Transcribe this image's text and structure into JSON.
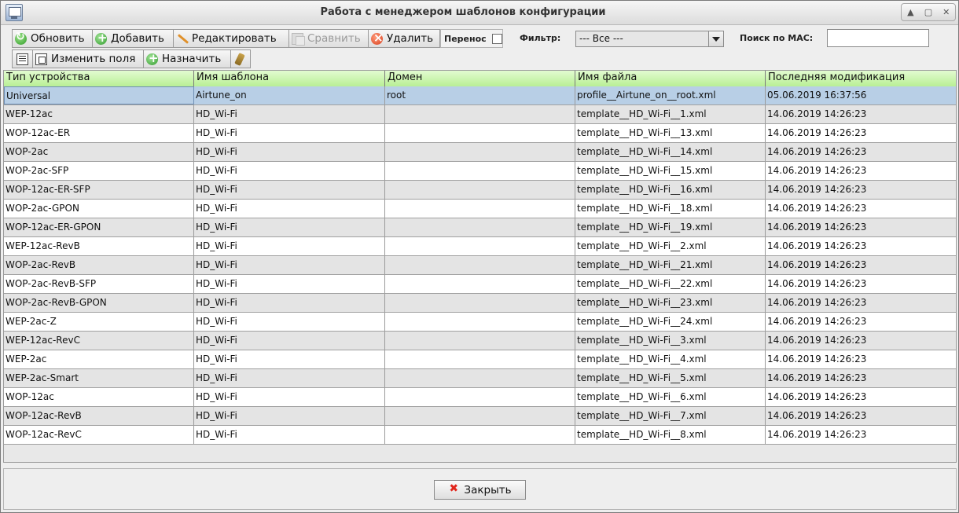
{
  "window": {
    "title": "Работа с менеджером шаблонов конфигурации",
    "controls": [
      "▲",
      "▢",
      "✕"
    ]
  },
  "toolbar": {
    "refresh_label": "Обновить",
    "add_label": "Добавить",
    "edit_label": "Редактировать",
    "compare_label": "Сравнить",
    "delete_label": "Удалить",
    "transfer_label": "Перенос",
    "transfer_checked": false,
    "change_fields_label": "Изменить поля",
    "assign_label": "Назначить",
    "filter_label": "Фильтр:",
    "filter_value": "--- Все ---",
    "mac_search_label": "Поиск по MAC:",
    "mac_search_value": ""
  },
  "table": {
    "columns": [
      "Тип устройства",
      "Имя шаблона",
      "Домен",
      "Имя файла",
      "Последняя модификация"
    ],
    "selected_row": 0,
    "rows": [
      [
        "Universal",
        "Airtune_on",
        "root",
        "profile__Airtune_on__root.xml",
        "05.06.2019 16:37:56"
      ],
      [
        "WEP-12ac",
        "HD_Wi-Fi",
        "",
        "template__HD_Wi-Fi__1.xml",
        "14.06.2019 14:26:23"
      ],
      [
        "WOP-12ac-ER",
        "HD_Wi-Fi",
        "",
        "template__HD_Wi-Fi__13.xml",
        "14.06.2019 14:26:23"
      ],
      [
        "WOP-2ac",
        "HD_Wi-Fi",
        "",
        "template__HD_Wi-Fi__14.xml",
        "14.06.2019 14:26:23"
      ],
      [
        "WOP-2ac-SFP",
        "HD_Wi-Fi",
        "",
        "template__HD_Wi-Fi__15.xml",
        "14.06.2019 14:26:23"
      ],
      [
        "WOP-12ac-ER-SFP",
        "HD_Wi-Fi",
        "",
        "template__HD_Wi-Fi__16.xml",
        "14.06.2019 14:26:23"
      ],
      [
        "WOP-2ac-GPON",
        "HD_Wi-Fi",
        "",
        "template__HD_Wi-Fi__18.xml",
        "14.06.2019 14:26:23"
      ],
      [
        "WOP-12ac-ER-GPON",
        "HD_Wi-Fi",
        "",
        "template__HD_Wi-Fi__19.xml",
        "14.06.2019 14:26:23"
      ],
      [
        "WEP-12ac-RevB",
        "HD_Wi-Fi",
        "",
        "template__HD_Wi-Fi__2.xml",
        "14.06.2019 14:26:23"
      ],
      [
        "WOP-2ac-RevB",
        "HD_Wi-Fi",
        "",
        "template__HD_Wi-Fi__21.xml",
        "14.06.2019 14:26:23"
      ],
      [
        "WOP-2ac-RevB-SFP",
        "HD_Wi-Fi",
        "",
        "template__HD_Wi-Fi__22.xml",
        "14.06.2019 14:26:23"
      ],
      [
        "WOP-2ac-RevB-GPON",
        "HD_Wi-Fi",
        "",
        "template__HD_Wi-Fi__23.xml",
        "14.06.2019 14:26:23"
      ],
      [
        "WEP-2ac-Z",
        "HD_Wi-Fi",
        "",
        "template__HD_Wi-Fi__24.xml",
        "14.06.2019 14:26:23"
      ],
      [
        "WEP-12ac-RevC",
        "HD_Wi-Fi",
        "",
        "template__HD_Wi-Fi__3.xml",
        "14.06.2019 14:26:23"
      ],
      [
        "WEP-2ac",
        "HD_Wi-Fi",
        "",
        "template__HD_Wi-Fi__4.xml",
        "14.06.2019 14:26:23"
      ],
      [
        "WEP-2ac-Smart",
        "HD_Wi-Fi",
        "",
        "template__HD_Wi-Fi__5.xml",
        "14.06.2019 14:26:23"
      ],
      [
        "WOP-12ac",
        "HD_Wi-Fi",
        "",
        "template__HD_Wi-Fi__6.xml",
        "14.06.2019 14:26:23"
      ],
      [
        "WOP-12ac-RevB",
        "HD_Wi-Fi",
        "",
        "template__HD_Wi-Fi__7.xml",
        "14.06.2019 14:26:23"
      ],
      [
        "WOP-12ac-RevC",
        "HD_Wi-Fi",
        "",
        "template__HD_Wi-Fi__8.xml",
        "14.06.2019 14:26:23"
      ]
    ]
  },
  "footer": {
    "close_label": "Закрыть"
  },
  "icons": {
    "refresh": "refresh-icon",
    "add": "add-icon",
    "edit": "pencil-icon",
    "compare": "compare-icon",
    "delete": "delete-icon",
    "columns": "list-icon",
    "change_fields": "fields-icon",
    "assign": "add-icon",
    "key": "key-icon",
    "close": "close-icon"
  },
  "colors": {
    "header_bg": "#c8f7a8",
    "selected_row": "#b8cfe6",
    "row_alt": "#e4e4e4",
    "close_icon": "#e1261c"
  }
}
